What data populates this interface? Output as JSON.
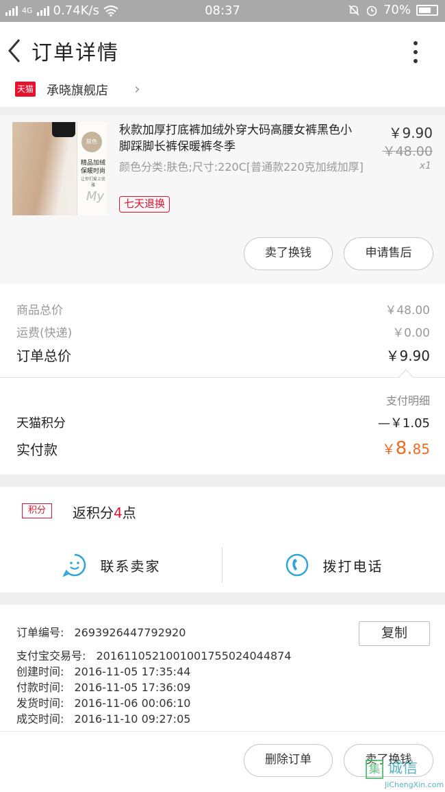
{
  "status_bar": {
    "net": "4G",
    "speed": "0.74K/s",
    "time": "08:37",
    "battery": "70%"
  },
  "header": {
    "title": "订单详情"
  },
  "shop": {
    "badge": "天猫",
    "name": "承晓旗舰店"
  },
  "product": {
    "title": "秋款加厚打底裤加绒外穿大码高腰女裤黑色小脚踩脚长裤保暖裤冬季",
    "spec": "颜色分类:肤色;尺寸:220C[普通款220克加绒加厚]",
    "tag": "七天退换",
    "price": "￥9.90",
    "original_price": "￥48.00",
    "qty": "x1",
    "thumb": {
      "tag": "肤色",
      "line1": "精品加绒",
      "line2": "保暖时尚",
      "line3": "让你们爱上优雅",
      "sign": "My"
    }
  },
  "buttons": {
    "sell": "卖了换钱",
    "aftersale": "申请售后",
    "delete": "删除订单",
    "sell2": "卖了换钱",
    "copy": "复制"
  },
  "summary": {
    "goods_total_label": "商品总价",
    "goods_total": "￥48.00",
    "shipping_label": "运费(快递)",
    "shipping": "￥0.00",
    "order_total_label": "订单总价",
    "order_total": "￥9.90"
  },
  "payment": {
    "detail_link": "支付明细",
    "points_label": "天猫积分",
    "points_value": "—￥1.05",
    "paid_label": "实付款",
    "paid_currency": "￥",
    "paid_int": "8.",
    "paid_dec": "85"
  },
  "rewards": {
    "badge": "积分",
    "text_prefix": "返积分",
    "count": "4",
    "text_suffix": "点"
  },
  "contact": {
    "seller": "联系卖家",
    "call": "拨打电话"
  },
  "order_info": {
    "order_no_label": "订单编号:",
    "order_no": "2693926447792920",
    "alipay_label": "支付宝交易号:",
    "alipay": "2016110521001001755024044874",
    "created_label": "创建时间:",
    "created": "2016-11-05 17:35:44",
    "paid_label": "付款时间:",
    "paid": "2016-11-05 17:36:09",
    "shipped_label": "发货时间:",
    "shipped": "2016-11-06 00:06:10",
    "done_label": "成交时间:",
    "done": "2016-11-10 09:27:05"
  },
  "watermark": {
    "cn": "诚信",
    "en": "JiChengXin.com",
    "mark": "集"
  },
  "colors": {
    "tmall_red": "#e8112d",
    "paid_orange": "#f26a21",
    "icon_blue": "#2ea4dc"
  }
}
